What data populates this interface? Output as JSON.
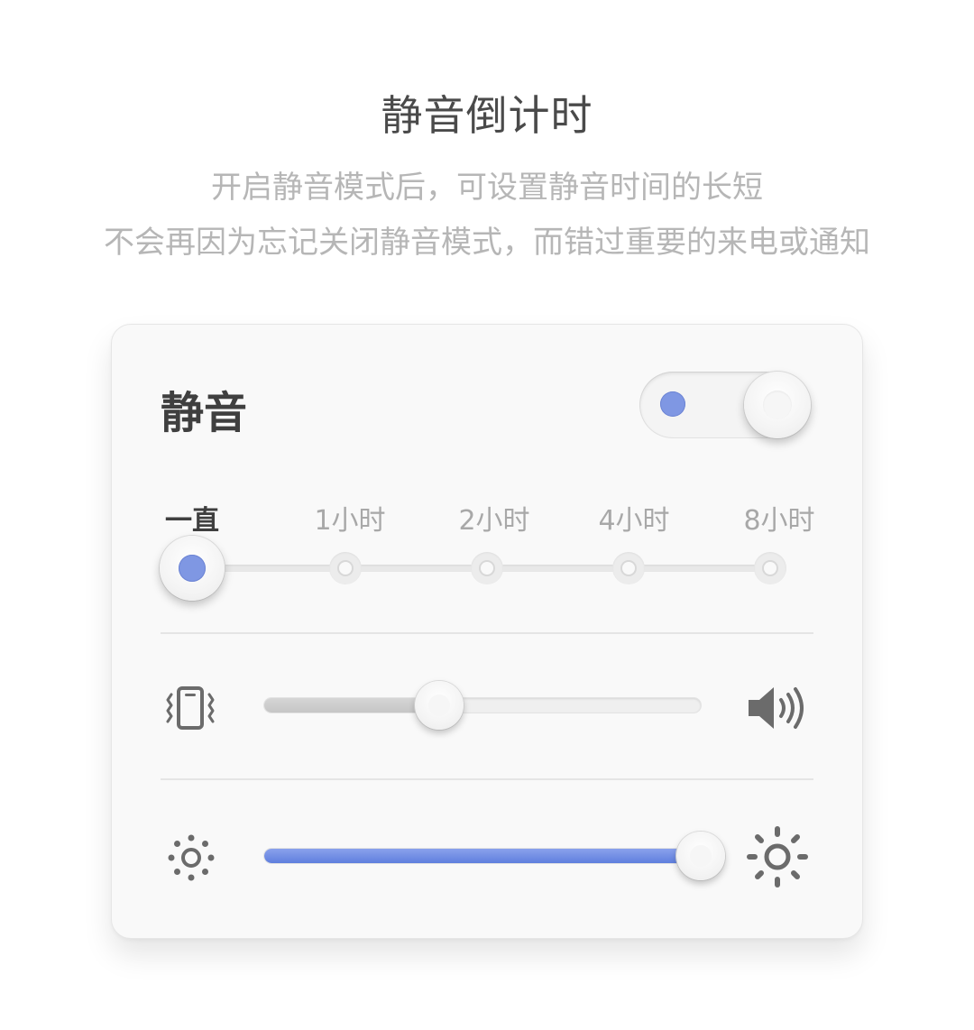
{
  "header": {
    "title": "静音倒计时",
    "subtitle_line1": "开启静音模式后，可设置静音时间的长短",
    "subtitle_line2": "不会再因为忘记关闭静音模式，而错过重要的来电或通知"
  },
  "card": {
    "title": "静音",
    "toggle": {
      "on": true
    },
    "timer": {
      "steps": [
        "一直",
        "1小时",
        "2小时",
        "4小时",
        "8小时"
      ],
      "selected_index": 0
    },
    "volume": {
      "level_percent": 40,
      "left_icon": "vibrate-phone-icon",
      "right_icon": "speaker-volume-icon"
    },
    "brightness": {
      "level_percent": 100,
      "left_icon": "brightness-low-icon",
      "right_icon": "brightness-high-icon"
    }
  },
  "colors": {
    "accent": "#7f97e3",
    "slider_fill": "#6f8ce4",
    "text_dark": "#3f3f3f",
    "text_muted": "#b6b6b6"
  }
}
